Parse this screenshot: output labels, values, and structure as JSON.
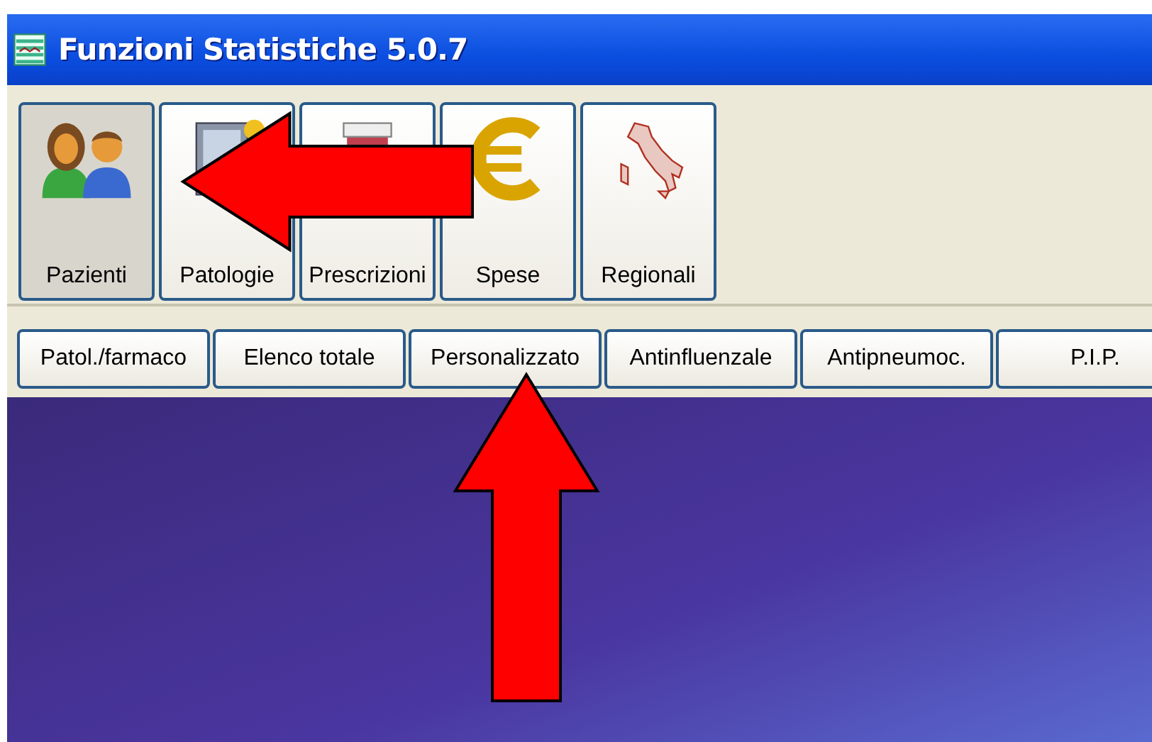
{
  "window": {
    "title": "Funzioni Statistiche 5.0.7"
  },
  "toolbar": [
    {
      "label": "Pazienti",
      "selected": true
    },
    {
      "label": "Patologie",
      "selected": false
    },
    {
      "label": "Prescrizioni",
      "selected": false
    },
    {
      "label": "Spese",
      "selected": false
    },
    {
      "label": "Regionali",
      "selected": false
    }
  ],
  "subtoolbar": [
    {
      "label": "Patol./farmaco"
    },
    {
      "label": "Elenco totale"
    },
    {
      "label": "Personalizzato"
    },
    {
      "label": "Antinfluenzale"
    },
    {
      "label": "Antipneumoc."
    },
    {
      "label": "P.I.P."
    }
  ],
  "annotations": [
    {
      "kind": "leftarrow"
    },
    {
      "kind": "uparrow"
    }
  ]
}
